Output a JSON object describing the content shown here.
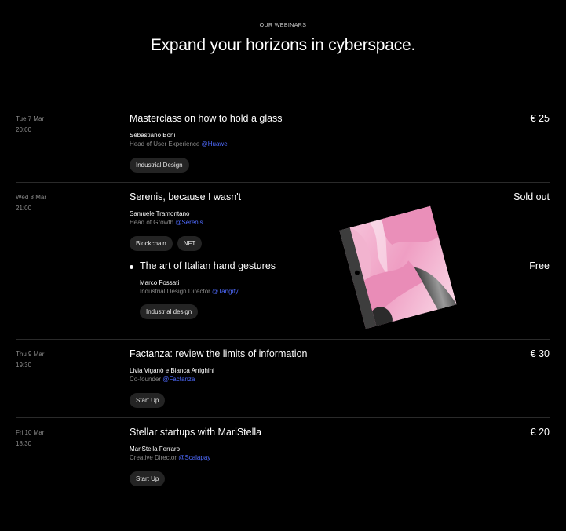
{
  "header": {
    "eyebrow": "OUR WEBINARS",
    "title": "Expand your horizons in cyberspace."
  },
  "colors": {
    "background": "#000000",
    "link": "#4f6bff",
    "tag_bg": "#242424",
    "muted": "#8a8a8a"
  },
  "webinars": [
    {
      "day": "Tue 7 Mar",
      "time": "20:00",
      "title": "Masterclass on how to hold a glass",
      "price": "€ 25",
      "speaker": "Sebastiano Boni",
      "role": "Head of User Experience",
      "company": "@Huawei",
      "tags": [
        "Industrial Design"
      ]
    },
    {
      "day": "Wed 8 Mar",
      "time": "21:00",
      "title": "Serenis, because I wasn't",
      "price": "Sold out",
      "speaker": "Samuele Tramontano",
      "role": "Head of Growth",
      "company": "@Serenis",
      "tags": [
        "Blockchain",
        "NFT"
      ],
      "sub": {
        "title": "The art of Italian hand gestures",
        "price": "Free",
        "speaker": "Marco Fossati",
        "role": "Industrial Design Director",
        "company": "@Tangity",
        "tags": [
          "Industrial design"
        ]
      }
    },
    {
      "day": "Thu 9 Mar",
      "time": "19:30",
      "title": "Factanza: review the limits of information",
      "price": "€ 30",
      "speaker": "Livia Viganò e Bianca Arrighini",
      "role": "Co-founder",
      "company": "@Factanza",
      "tags": [
        "Start Up"
      ]
    },
    {
      "day": "Fri 10 Mar",
      "time": "18:30",
      "title": "Stellar startups with MariStella",
      "price": "€ 20",
      "speaker": "MariStella Ferraro",
      "role": "Creative Director",
      "company": "@Scalapay",
      "tags": [
        "Start Up"
      ]
    }
  ],
  "art": {
    "name": "abstract-pink-artwork"
  }
}
